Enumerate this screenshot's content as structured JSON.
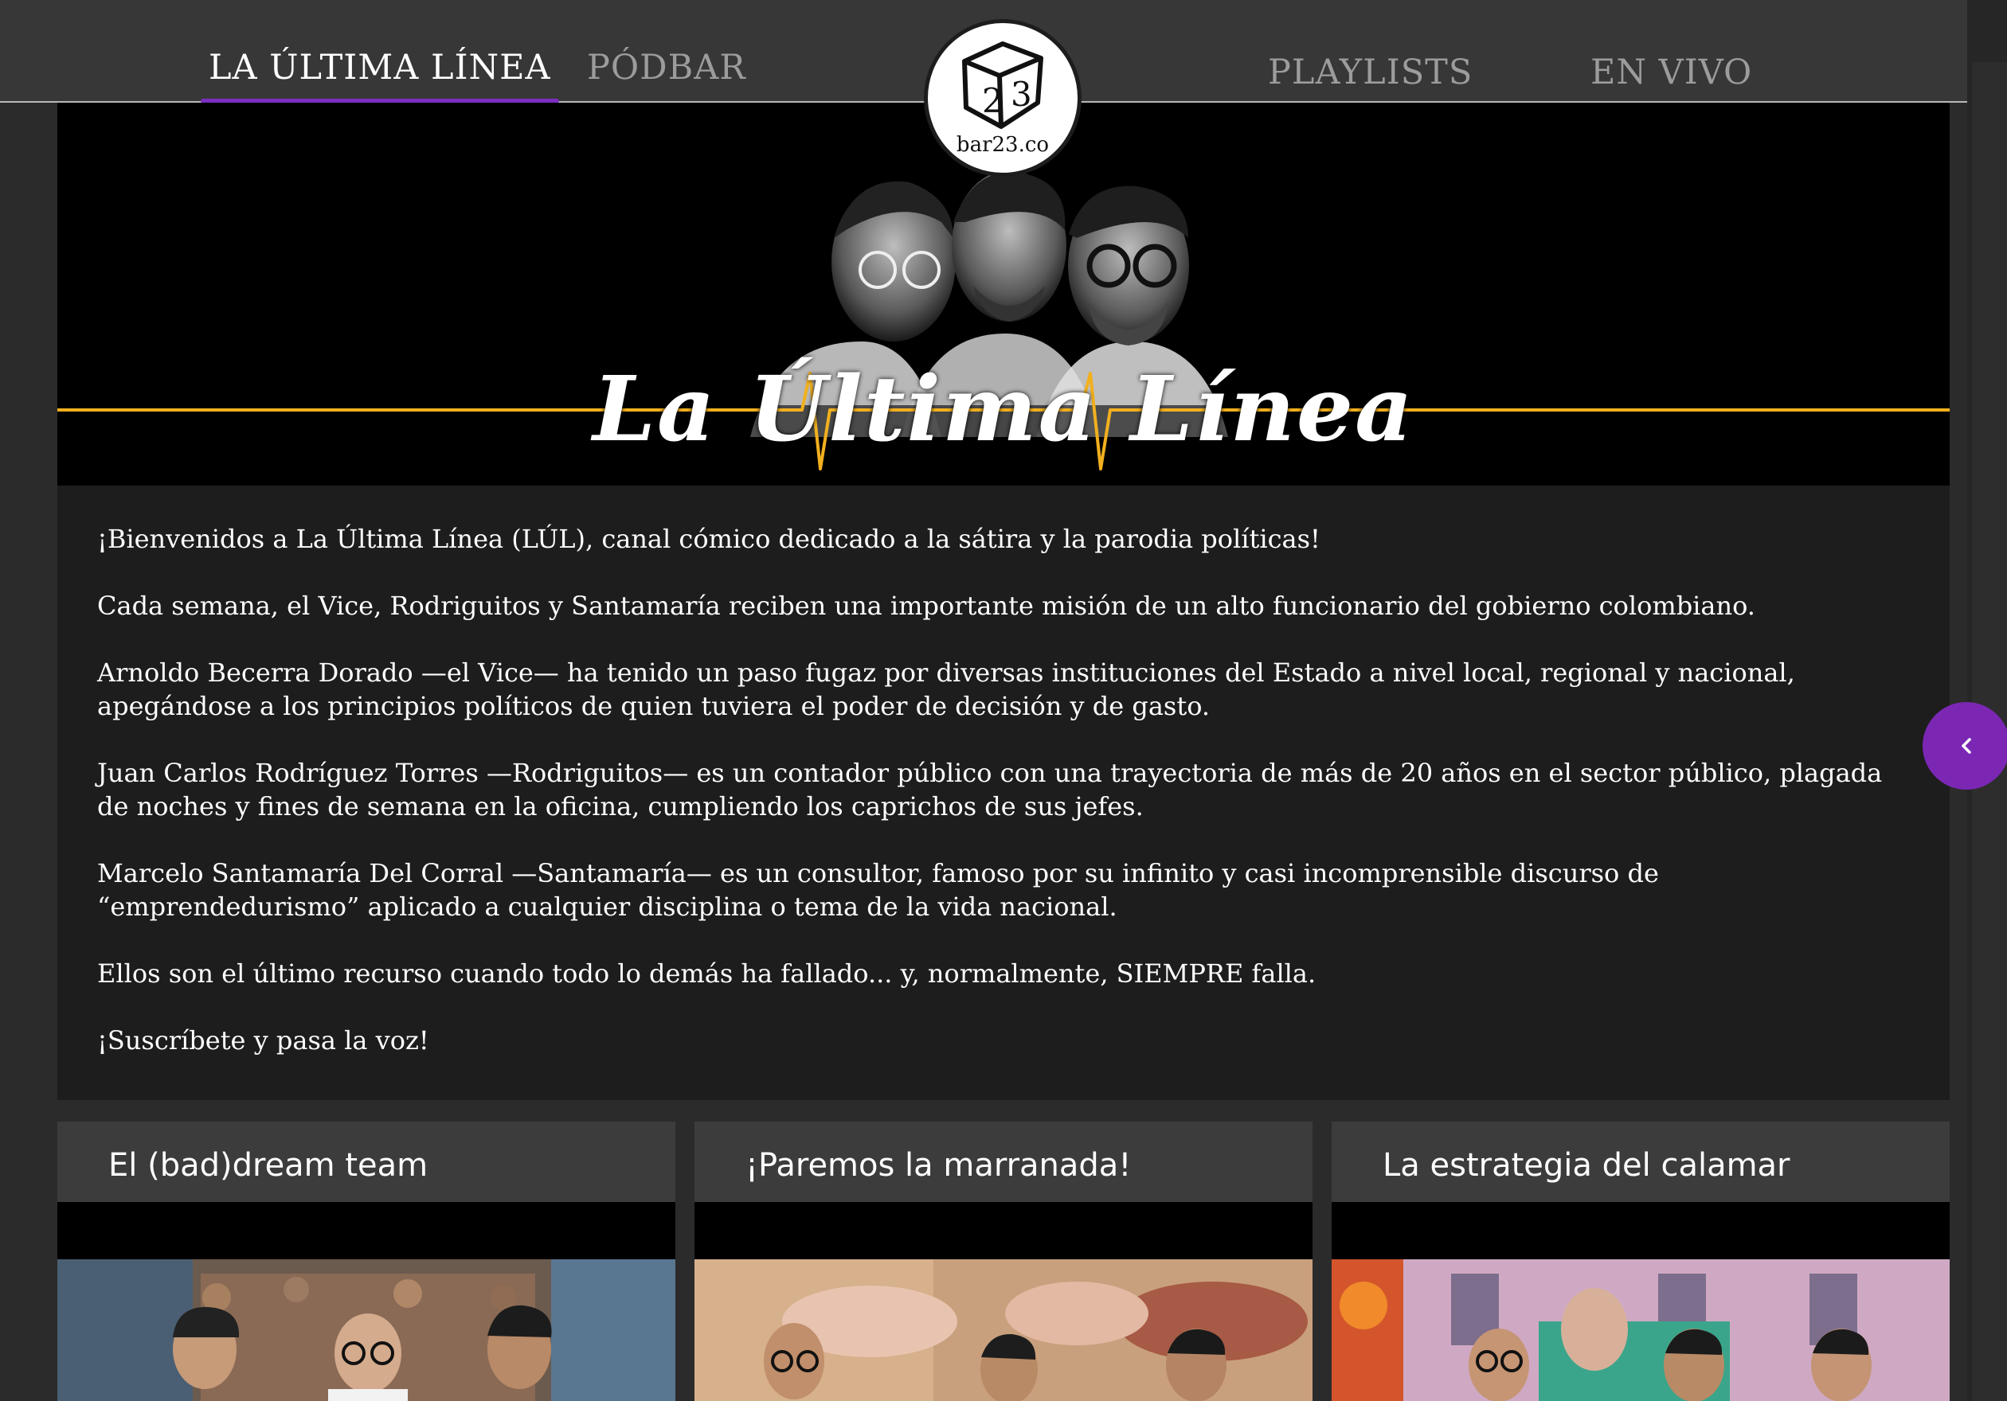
{
  "nav": {
    "items": [
      {
        "label": "LA ÚLTIMA LÍNEA",
        "active": true
      },
      {
        "label": "PÓDBAR",
        "active": false
      },
      {
        "label": "PLAYLISTS",
        "active": false
      },
      {
        "label": "EN VIVO",
        "active": false
      }
    ],
    "logo_text": "bar23.co",
    "accent_color": "#7b2ec0"
  },
  "hero": {
    "title": "La Última Línea",
    "line_color": "#f2b01e"
  },
  "description": {
    "paragraphs": [
      "¡Bienvenidos a La Última Línea (LÚL), canal cómico dedicado a la sátira y la parodia políticas!",
      "Cada semana, el Vice, Rodriguitos y Santamaría reciben una importante misión de un alto funcionario del gobierno colombiano.",
      "Arnoldo Becerra Dorado —el Vice— ha tenido un paso fugaz por diversas instituciones del Estado a nivel local, regional y nacional, apegándose a los principios políticos de quien tuviera el poder de decisión y de gasto.",
      "Juan Carlos Rodríguez Torres —Rodriguitos— es un contador público con una trayectoria de más de 20 años en el sector público, plagada de noches y fines de semana en la oficina, cumpliendo los caprichos de sus jefes.",
      "Marcelo Santamaría Del Corral —Santamaría— es un consultor, famoso por su infinito y casi incomprensible discurso de “emprendedurismo” aplicado a cualquier disciplina o tema de la vida nacional.",
      "Ellos son el último recurso cuando todo lo demás ha fallado... y, normalmente, SIEMPRE falla.",
      "¡Suscríbete y pasa la voz!"
    ]
  },
  "side_button": {
    "icon": "chevron-left-icon",
    "color": "#7b27b4"
  },
  "cards": [
    {
      "title": "El (bad)dream team"
    },
    {
      "title": "¡Paremos la marranada!"
    },
    {
      "title": "La estrategia del calamar"
    }
  ]
}
